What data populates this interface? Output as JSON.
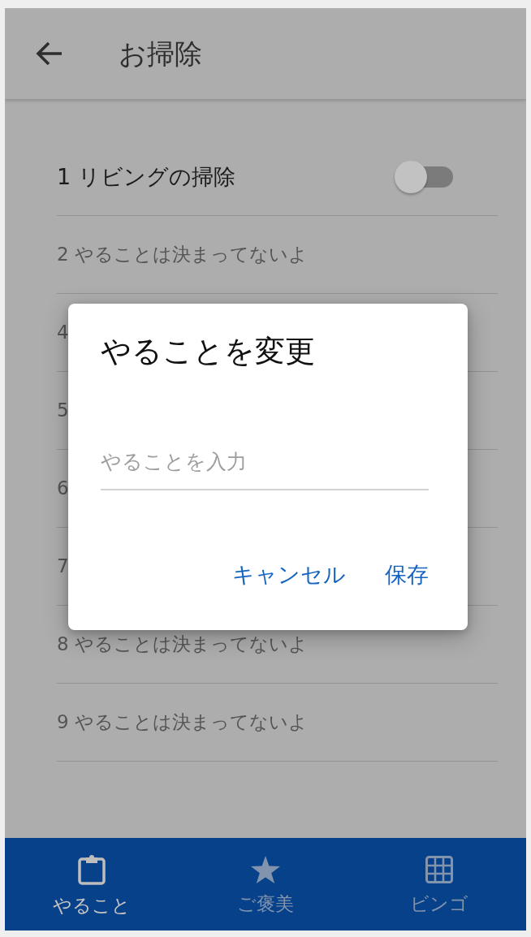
{
  "app_bar": {
    "title": "お掃除"
  },
  "tasks": [
    {
      "label": "1 リビングの掃除",
      "kind": "task",
      "on": false
    },
    {
      "label": "2 やることは決まってないよ",
      "kind": "empty"
    },
    {
      "label": "4",
      "kind": "covered"
    },
    {
      "label": "5",
      "kind": "covered"
    },
    {
      "label": "6",
      "kind": "covered"
    },
    {
      "label": "7",
      "kind": "covered"
    },
    {
      "label": "8 やることは決まってないよ",
      "kind": "empty"
    },
    {
      "label": "9 やることは決まってないよ",
      "kind": "empty"
    }
  ],
  "dialog": {
    "title": "やることを変更",
    "input": {
      "placeholder": "やることを入力"
    },
    "buttons": [
      "キャンセル",
      "保存"
    ]
  },
  "bottom_nav": [
    {
      "label": "やること",
      "selected": true
    },
    {
      "label": "ご褒美",
      "selected": false
    },
    {
      "label": "ビンゴ",
      "selected": false
    }
  ]
}
